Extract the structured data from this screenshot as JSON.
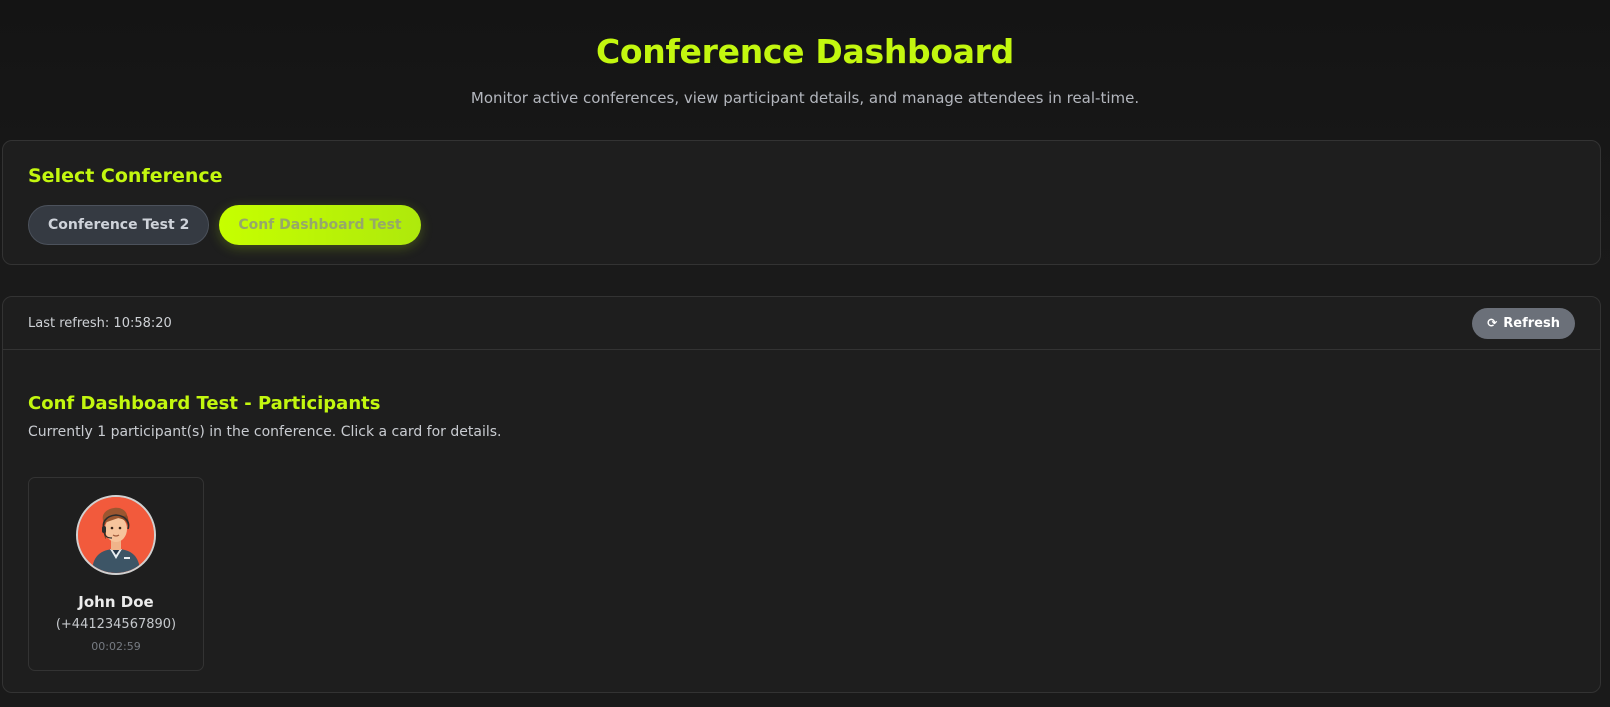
{
  "header": {
    "title": "Conference Dashboard",
    "subtitle": "Monitor active conferences, view participant details, and manage attendees in real-time."
  },
  "select_conference": {
    "heading": "Select Conference",
    "options": [
      {
        "label": "Conference Test 2",
        "active": false
      },
      {
        "label": "Conf Dashboard Test",
        "active": true
      }
    ]
  },
  "toolbar": {
    "last_refresh": "Last refresh: 10:58:20",
    "refresh_icon": "refresh-icon",
    "refresh_label": "Refresh"
  },
  "participants": {
    "heading": "Conf Dashboard Test - Participants",
    "count_text": "Currently 1 participant(s) in the conference. Click a card for details.",
    "list": [
      {
        "name": "John Doe",
        "phone": "(+441234567890)",
        "duration": "00:02:59",
        "avatar": "avatar-man-with-headset"
      }
    ]
  },
  "colors": {
    "accent": "#c3f70f",
    "background": "#1a1a1a",
    "card": "#1e1e1e",
    "avatar_bg": "#f25a3c"
  }
}
